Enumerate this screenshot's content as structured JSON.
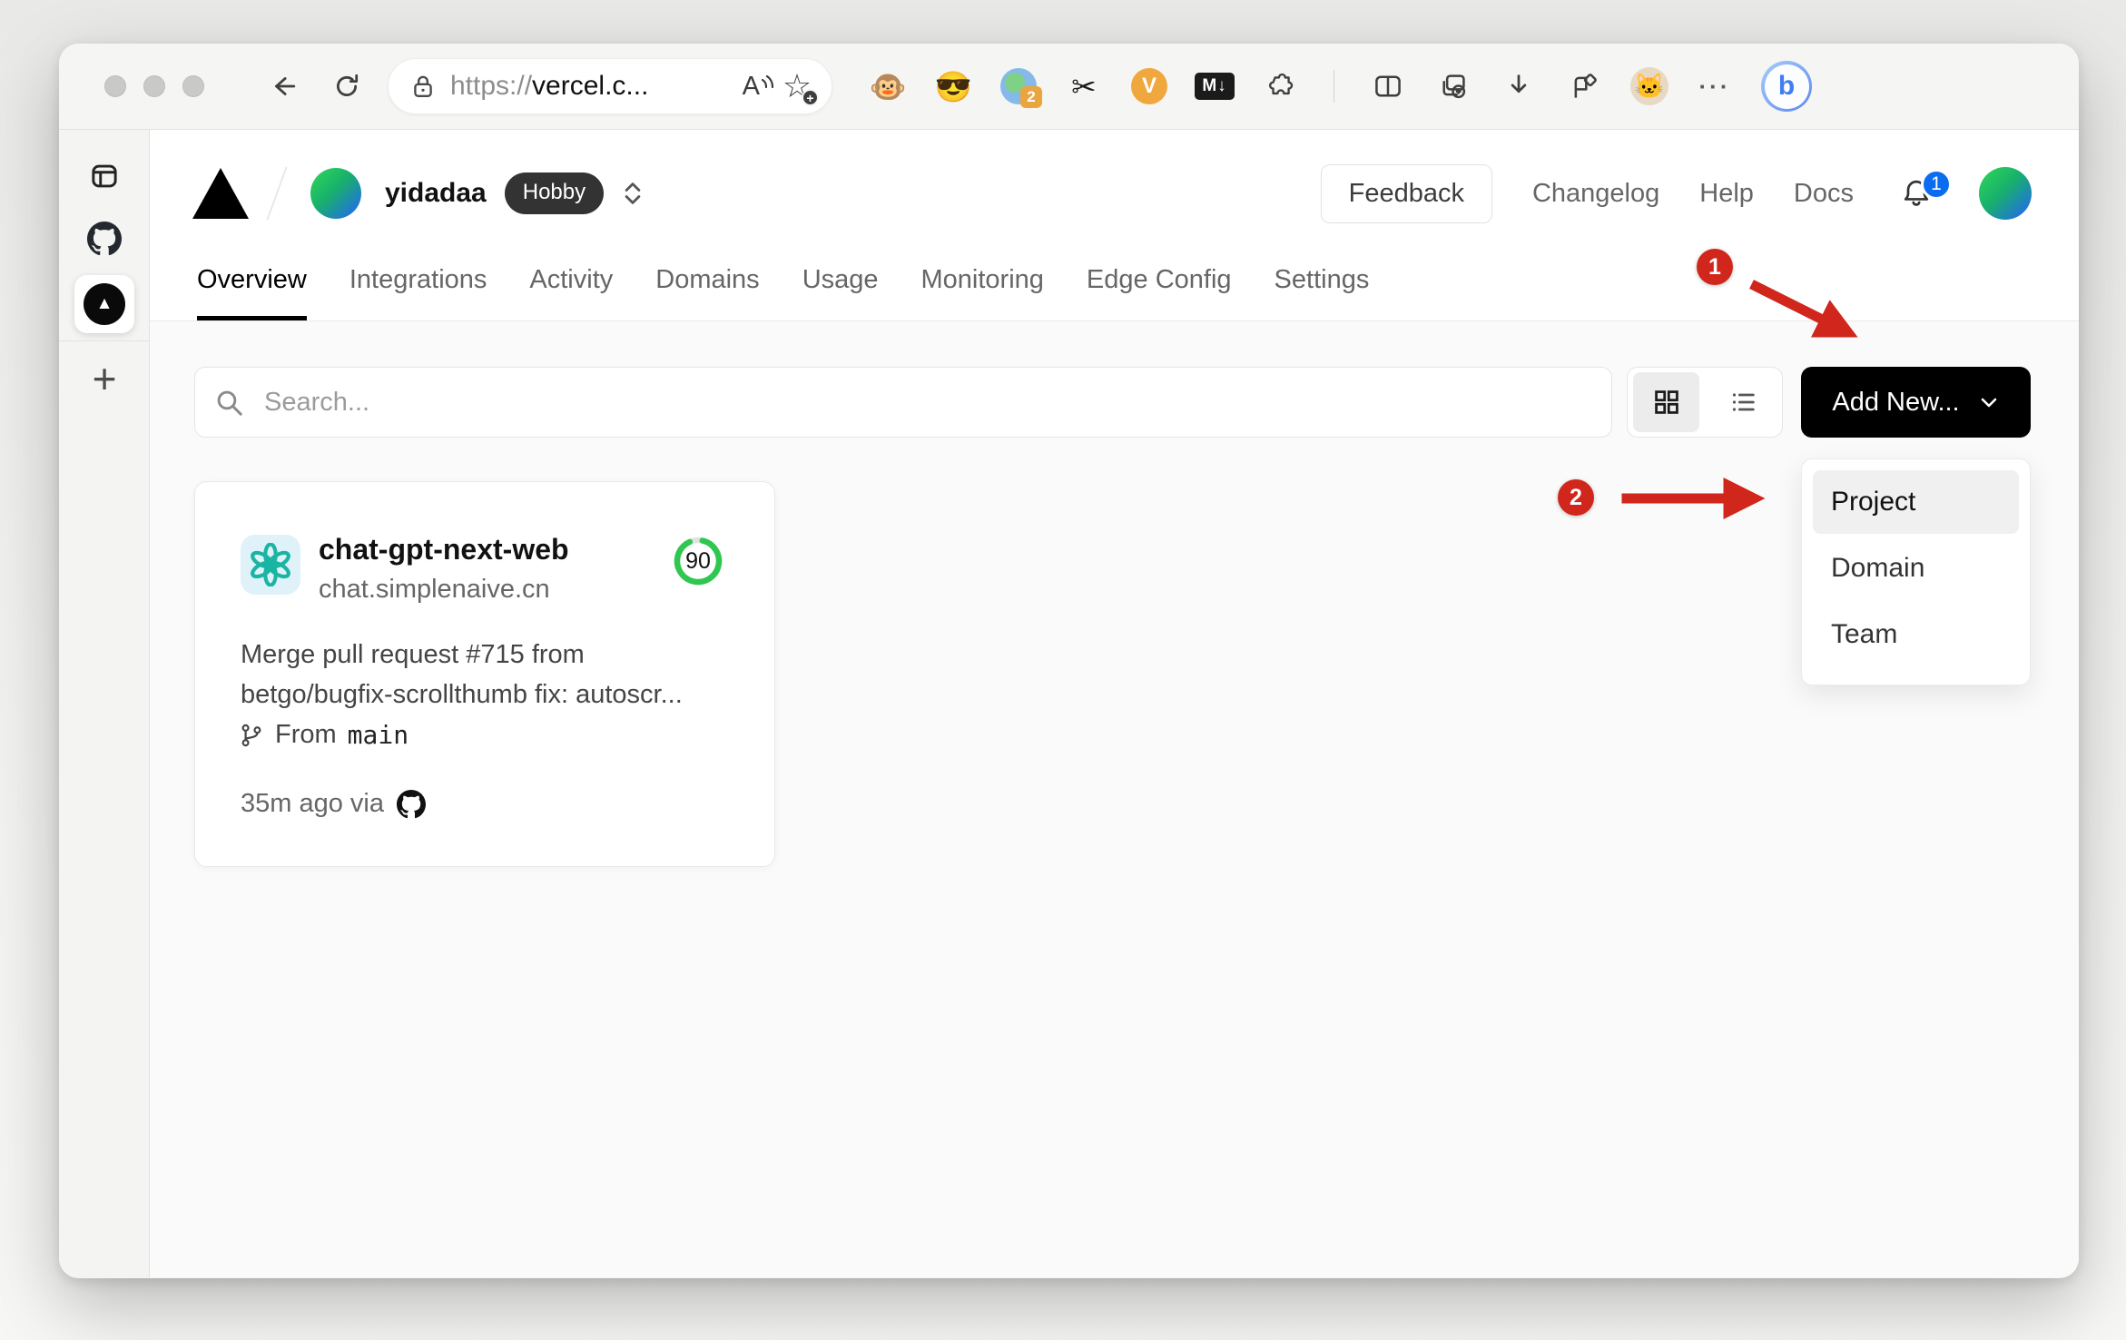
{
  "colors": {
    "annotation_red": "#d0261b",
    "notification_blue": "#0b6cf0",
    "score_green": "#2fc74f",
    "openai_teal": "#1ab5a2",
    "accent_black": "#000000"
  },
  "icons": {
    "tampermonkey_glyph": "🐵",
    "avatar_glasses_glyph": "😎",
    "scissors_glyph": "✂",
    "cat_glyph": "🐱",
    "more_glyph": "···",
    "new_tab_glyph": "+",
    "star_glyph": "☆"
  },
  "browser": {
    "url": {
      "scheme": "https://",
      "host": "vercel.c..."
    },
    "read_aloud_label": "A",
    "extensions": {
      "collab_badge": "2",
      "vk_label": "V",
      "markdown_label": "M↓",
      "bing_label": "b",
      "star_add_label": "+"
    }
  },
  "vercel": {
    "breadcrumb": {
      "team": "yidadaa",
      "plan": "Hobby"
    },
    "header": {
      "feedback": "Feedback",
      "changelog": "Changelog",
      "help": "Help",
      "docs": "Docs",
      "notification_count": "1"
    },
    "tabs": [
      {
        "label": "Overview",
        "active": true
      },
      {
        "label": "Integrations",
        "active": false
      },
      {
        "label": "Activity",
        "active": false
      },
      {
        "label": "Domains",
        "active": false
      },
      {
        "label": "Usage",
        "active": false
      },
      {
        "label": "Monitoring",
        "active": false
      },
      {
        "label": "Edge Config",
        "active": false
      },
      {
        "label": "Settings",
        "active": false
      }
    ],
    "toolbar": {
      "search_placeholder": "Search...",
      "add_new": "Add New..."
    },
    "dropdown": {
      "items": [
        {
          "label": "Project",
          "highlighted": true
        },
        {
          "label": "Domain",
          "highlighted": false
        },
        {
          "label": "Team",
          "highlighted": false
        }
      ]
    },
    "project_card": {
      "name": "chat-gpt-next-web",
      "domain": "chat.simplenaive.cn",
      "score": "90",
      "commit_line1": "Merge pull request #715 from",
      "commit_line2": "betgo/bugfix-scrollthumb fix: autoscr...",
      "from_label": "From",
      "branch": "main",
      "deployed_label": "35m ago via"
    },
    "annotations": {
      "step1": "1",
      "step2": "2"
    }
  }
}
